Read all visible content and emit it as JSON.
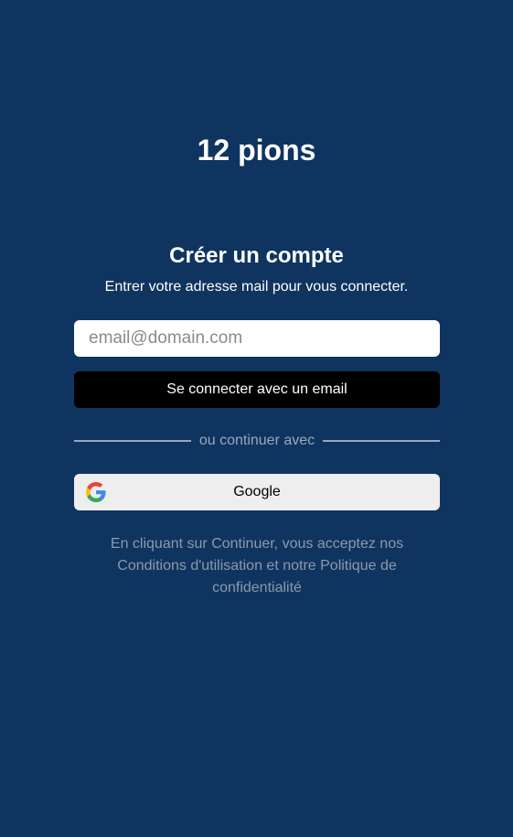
{
  "app": {
    "title": "12 pions"
  },
  "signup": {
    "heading": "Créer un compte",
    "subheading": "Entrer votre adresse mail pour vous connecter.",
    "email_placeholder": "email@domain.com",
    "email_value": "",
    "email_button_label": "Se connecter avec un email",
    "divider_text": "ou continuer avec",
    "google_button_label": "Google",
    "google_icon": "google-g-logo",
    "legal_text": "En cliquant sur Continuer, vous acceptez nos Conditions d'utilisation et notre Politique de confidentialité"
  },
  "colors": {
    "background": "#0f3460",
    "primary_button": "#000000",
    "secondary_button": "#eeeeee",
    "muted_text": "#8d99ab"
  }
}
